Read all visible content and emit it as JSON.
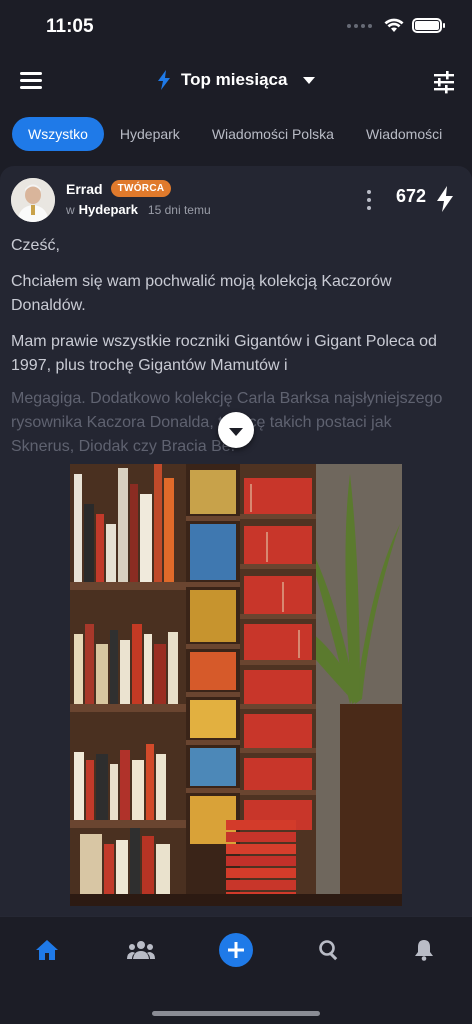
{
  "status": {
    "time": "11:05"
  },
  "header": {
    "title": "Top miesiąca"
  },
  "tabs": [
    {
      "label": "Wszystko",
      "active": true
    },
    {
      "label": "Hydepark",
      "active": false
    },
    {
      "label": "Wiadomości Polska",
      "active": false
    },
    {
      "label": "Wiadomości",
      "active": false
    }
  ],
  "post": {
    "author": "Errad",
    "badge": "TWÓRCA",
    "prefix": "w",
    "community": "Hydepark",
    "time_ago": "15 dni temu",
    "score": "672",
    "paragraphs": [
      "Cześć,",
      "Chciałem się wam pochwalić moją kolekcją Kaczorów Donaldów.",
      "Mam prawie wszystkie roczniki Gigantów i Gigant Poleca od 1997, plus trochę Gigantów Mamutów i"
    ],
    "faded_text": "Megagiga. Dodatkowo kolekcję Carla Barksa najsłyniejszego rysownika Kaczora Donalda, twórcę takich postaci jak Sknerus, Diodak czy Bracia Be."
  },
  "colors": {
    "accent": "#1f7ae8",
    "badge": "#e07a2c",
    "background": "#1c1d26",
    "card": "#242632"
  },
  "icons": {
    "menu": "hamburger-icon",
    "bolt": "bolt-icon",
    "filter": "sliders-icon",
    "home": "home-icon",
    "people": "people-icon",
    "add": "plus-icon",
    "search": "search-icon",
    "bell": "bell-icon"
  }
}
